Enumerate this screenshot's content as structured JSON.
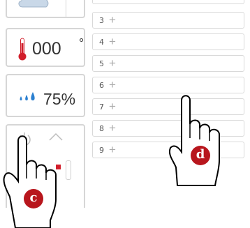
{
  "temperature": {
    "value": "000",
    "unit": "°"
  },
  "humidity": {
    "value": "75%"
  },
  "rows": [
    {
      "num": "3",
      "plus": "+"
    },
    {
      "num": "4",
      "plus": "+"
    },
    {
      "num": "5",
      "plus": "+"
    },
    {
      "num": "6",
      "plus": "+"
    },
    {
      "num": "7",
      "plus": "+"
    },
    {
      "num": "8",
      "plus": "+"
    },
    {
      "num": "9",
      "plus": "+"
    }
  ],
  "annotations": {
    "hand_c": "c",
    "hand_d": "d"
  },
  "colors": {
    "accent": "#d21e2b",
    "badge": "#b8161d",
    "drop": "#2a7fd0",
    "border": "#d6d6d6"
  },
  "icons": [
    "cloud-icon",
    "thermometer-icon",
    "water-drops-icon",
    "power-icon",
    "chevron-up-icon",
    "plus-icon"
  ]
}
